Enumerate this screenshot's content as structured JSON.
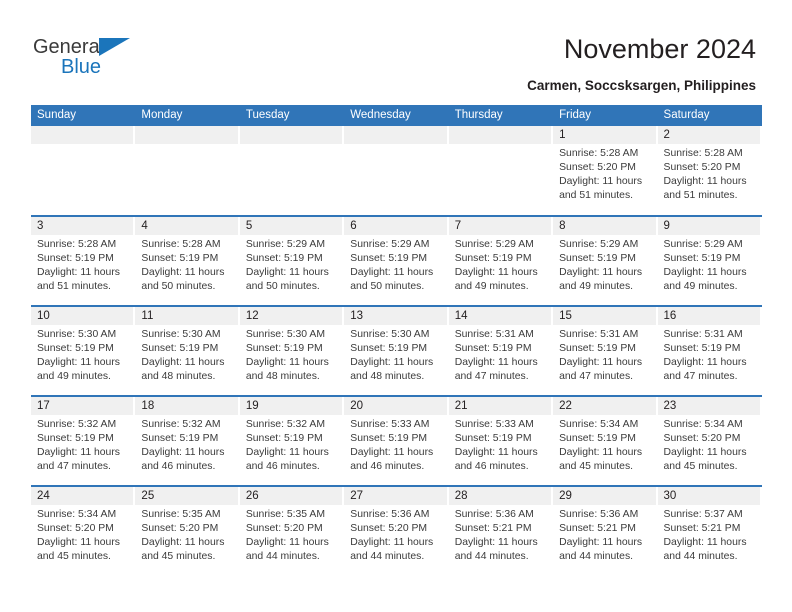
{
  "brand": {
    "name_part1": "General",
    "name_part2": "Blue",
    "triangle_color": "#1b75bb"
  },
  "header": {
    "title": "November 2024",
    "subtitle": "Carmen, Soccsksargen, Philippines"
  },
  "calendar": {
    "accent_color": "#3075b8",
    "daynum_bg": "#f0f0f0",
    "weekday_headers": [
      "Sunday",
      "Monday",
      "Tuesday",
      "Wednesday",
      "Thursday",
      "Friday",
      "Saturday"
    ],
    "weeks": [
      [
        {
          "day": "",
          "sunrise": "",
          "sunset": "",
          "daylight1": "",
          "daylight2": "",
          "empty": true
        },
        {
          "day": "",
          "sunrise": "",
          "sunset": "",
          "daylight1": "",
          "daylight2": "",
          "empty": true
        },
        {
          "day": "",
          "sunrise": "",
          "sunset": "",
          "daylight1": "",
          "daylight2": "",
          "empty": true
        },
        {
          "day": "",
          "sunrise": "",
          "sunset": "",
          "daylight1": "",
          "daylight2": "",
          "empty": true
        },
        {
          "day": "",
          "sunrise": "",
          "sunset": "",
          "daylight1": "",
          "daylight2": "",
          "empty": true
        },
        {
          "day": "1",
          "sunrise": "Sunrise: 5:28 AM",
          "sunset": "Sunset: 5:20 PM",
          "daylight1": "Daylight: 11 hours",
          "daylight2": "and 51 minutes.",
          "empty": false
        },
        {
          "day": "2",
          "sunrise": "Sunrise: 5:28 AM",
          "sunset": "Sunset: 5:20 PM",
          "daylight1": "Daylight: 11 hours",
          "daylight2": "and 51 minutes.",
          "empty": false
        }
      ],
      [
        {
          "day": "3",
          "sunrise": "Sunrise: 5:28 AM",
          "sunset": "Sunset: 5:19 PM",
          "daylight1": "Daylight: 11 hours",
          "daylight2": "and 51 minutes.",
          "empty": false
        },
        {
          "day": "4",
          "sunrise": "Sunrise: 5:28 AM",
          "sunset": "Sunset: 5:19 PM",
          "daylight1": "Daylight: 11 hours",
          "daylight2": "and 50 minutes.",
          "empty": false
        },
        {
          "day": "5",
          "sunrise": "Sunrise: 5:29 AM",
          "sunset": "Sunset: 5:19 PM",
          "daylight1": "Daylight: 11 hours",
          "daylight2": "and 50 minutes.",
          "empty": false
        },
        {
          "day": "6",
          "sunrise": "Sunrise: 5:29 AM",
          "sunset": "Sunset: 5:19 PM",
          "daylight1": "Daylight: 11 hours",
          "daylight2": "and 50 minutes.",
          "empty": false
        },
        {
          "day": "7",
          "sunrise": "Sunrise: 5:29 AM",
          "sunset": "Sunset: 5:19 PM",
          "daylight1": "Daylight: 11 hours",
          "daylight2": "and 49 minutes.",
          "empty": false
        },
        {
          "day": "8",
          "sunrise": "Sunrise: 5:29 AM",
          "sunset": "Sunset: 5:19 PM",
          "daylight1": "Daylight: 11 hours",
          "daylight2": "and 49 minutes.",
          "empty": false
        },
        {
          "day": "9",
          "sunrise": "Sunrise: 5:29 AM",
          "sunset": "Sunset: 5:19 PM",
          "daylight1": "Daylight: 11 hours",
          "daylight2": "and 49 minutes.",
          "empty": false
        }
      ],
      [
        {
          "day": "10",
          "sunrise": "Sunrise: 5:30 AM",
          "sunset": "Sunset: 5:19 PM",
          "daylight1": "Daylight: 11 hours",
          "daylight2": "and 49 minutes.",
          "empty": false
        },
        {
          "day": "11",
          "sunrise": "Sunrise: 5:30 AM",
          "sunset": "Sunset: 5:19 PM",
          "daylight1": "Daylight: 11 hours",
          "daylight2": "and 48 minutes.",
          "empty": false
        },
        {
          "day": "12",
          "sunrise": "Sunrise: 5:30 AM",
          "sunset": "Sunset: 5:19 PM",
          "daylight1": "Daylight: 11 hours",
          "daylight2": "and 48 minutes.",
          "empty": false
        },
        {
          "day": "13",
          "sunrise": "Sunrise: 5:30 AM",
          "sunset": "Sunset: 5:19 PM",
          "daylight1": "Daylight: 11 hours",
          "daylight2": "and 48 minutes.",
          "empty": false
        },
        {
          "day": "14",
          "sunrise": "Sunrise: 5:31 AM",
          "sunset": "Sunset: 5:19 PM",
          "daylight1": "Daylight: 11 hours",
          "daylight2": "and 47 minutes.",
          "empty": false
        },
        {
          "day": "15",
          "sunrise": "Sunrise: 5:31 AM",
          "sunset": "Sunset: 5:19 PM",
          "daylight1": "Daylight: 11 hours",
          "daylight2": "and 47 minutes.",
          "empty": false
        },
        {
          "day": "16",
          "sunrise": "Sunrise: 5:31 AM",
          "sunset": "Sunset: 5:19 PM",
          "daylight1": "Daylight: 11 hours",
          "daylight2": "and 47 minutes.",
          "empty": false
        }
      ],
      [
        {
          "day": "17",
          "sunrise": "Sunrise: 5:32 AM",
          "sunset": "Sunset: 5:19 PM",
          "daylight1": "Daylight: 11 hours",
          "daylight2": "and 47 minutes.",
          "empty": false
        },
        {
          "day": "18",
          "sunrise": "Sunrise: 5:32 AM",
          "sunset": "Sunset: 5:19 PM",
          "daylight1": "Daylight: 11 hours",
          "daylight2": "and 46 minutes.",
          "empty": false
        },
        {
          "day": "19",
          "sunrise": "Sunrise: 5:32 AM",
          "sunset": "Sunset: 5:19 PM",
          "daylight1": "Daylight: 11 hours",
          "daylight2": "and 46 minutes.",
          "empty": false
        },
        {
          "day": "20",
          "sunrise": "Sunrise: 5:33 AM",
          "sunset": "Sunset: 5:19 PM",
          "daylight1": "Daylight: 11 hours",
          "daylight2": "and 46 minutes.",
          "empty": false
        },
        {
          "day": "21",
          "sunrise": "Sunrise: 5:33 AM",
          "sunset": "Sunset: 5:19 PM",
          "daylight1": "Daylight: 11 hours",
          "daylight2": "and 46 minutes.",
          "empty": false
        },
        {
          "day": "22",
          "sunrise": "Sunrise: 5:34 AM",
          "sunset": "Sunset: 5:19 PM",
          "daylight1": "Daylight: 11 hours",
          "daylight2": "and 45 minutes.",
          "empty": false
        },
        {
          "day": "23",
          "sunrise": "Sunrise: 5:34 AM",
          "sunset": "Sunset: 5:20 PM",
          "daylight1": "Daylight: 11 hours",
          "daylight2": "and 45 minutes.",
          "empty": false
        }
      ],
      [
        {
          "day": "24",
          "sunrise": "Sunrise: 5:34 AM",
          "sunset": "Sunset: 5:20 PM",
          "daylight1": "Daylight: 11 hours",
          "daylight2": "and 45 minutes.",
          "empty": false
        },
        {
          "day": "25",
          "sunrise": "Sunrise: 5:35 AM",
          "sunset": "Sunset: 5:20 PM",
          "daylight1": "Daylight: 11 hours",
          "daylight2": "and 45 minutes.",
          "empty": false
        },
        {
          "day": "26",
          "sunrise": "Sunrise: 5:35 AM",
          "sunset": "Sunset: 5:20 PM",
          "daylight1": "Daylight: 11 hours",
          "daylight2": "and 44 minutes.",
          "empty": false
        },
        {
          "day": "27",
          "sunrise": "Sunrise: 5:36 AM",
          "sunset": "Sunset: 5:20 PM",
          "daylight1": "Daylight: 11 hours",
          "daylight2": "and 44 minutes.",
          "empty": false
        },
        {
          "day": "28",
          "sunrise": "Sunrise: 5:36 AM",
          "sunset": "Sunset: 5:21 PM",
          "daylight1": "Daylight: 11 hours",
          "daylight2": "and 44 minutes.",
          "empty": false
        },
        {
          "day": "29",
          "sunrise": "Sunrise: 5:36 AM",
          "sunset": "Sunset: 5:21 PM",
          "daylight1": "Daylight: 11 hours",
          "daylight2": "and 44 minutes.",
          "empty": false
        },
        {
          "day": "30",
          "sunrise": "Sunrise: 5:37 AM",
          "sunset": "Sunset: 5:21 PM",
          "daylight1": "Daylight: 11 hours",
          "daylight2": "and 44 minutes.",
          "empty": false
        }
      ]
    ]
  }
}
